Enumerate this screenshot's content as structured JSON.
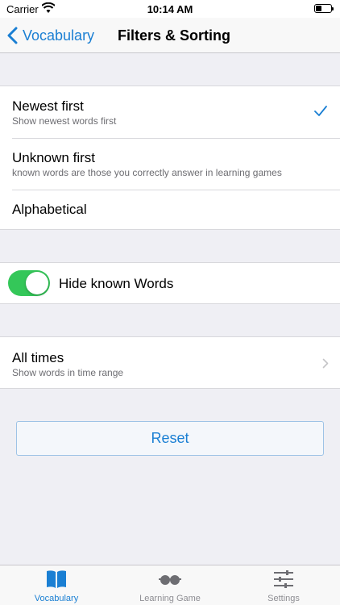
{
  "status_bar": {
    "carrier": "Carrier",
    "time": "10:14 AM"
  },
  "nav": {
    "back_label": "Vocabulary",
    "title": "Filters & Sorting"
  },
  "sort_options": [
    {
      "title": "Newest first",
      "subtitle": "Show newest words first",
      "selected": true
    },
    {
      "title": "Unknown first",
      "subtitle": "known words are those you correctly answer in learning games",
      "selected": false
    },
    {
      "title": "Alphabetical",
      "subtitle": "",
      "selected": false
    }
  ],
  "hide_known": {
    "label": "Hide known Words",
    "on": true
  },
  "time_range": {
    "title": "All times",
    "subtitle": "Show words in time range"
  },
  "reset_label": "Reset",
  "tabs": [
    {
      "label": "Vocabulary",
      "icon": "book-icon",
      "active": true
    },
    {
      "label": "Learning Game",
      "icon": "glasses-icon",
      "active": false
    },
    {
      "label": "Settings",
      "icon": "sliders-icon",
      "active": false
    }
  ],
  "colors": {
    "accent": "#1a7fd3",
    "toggle_on": "#34c759",
    "background": "#efeff4"
  }
}
